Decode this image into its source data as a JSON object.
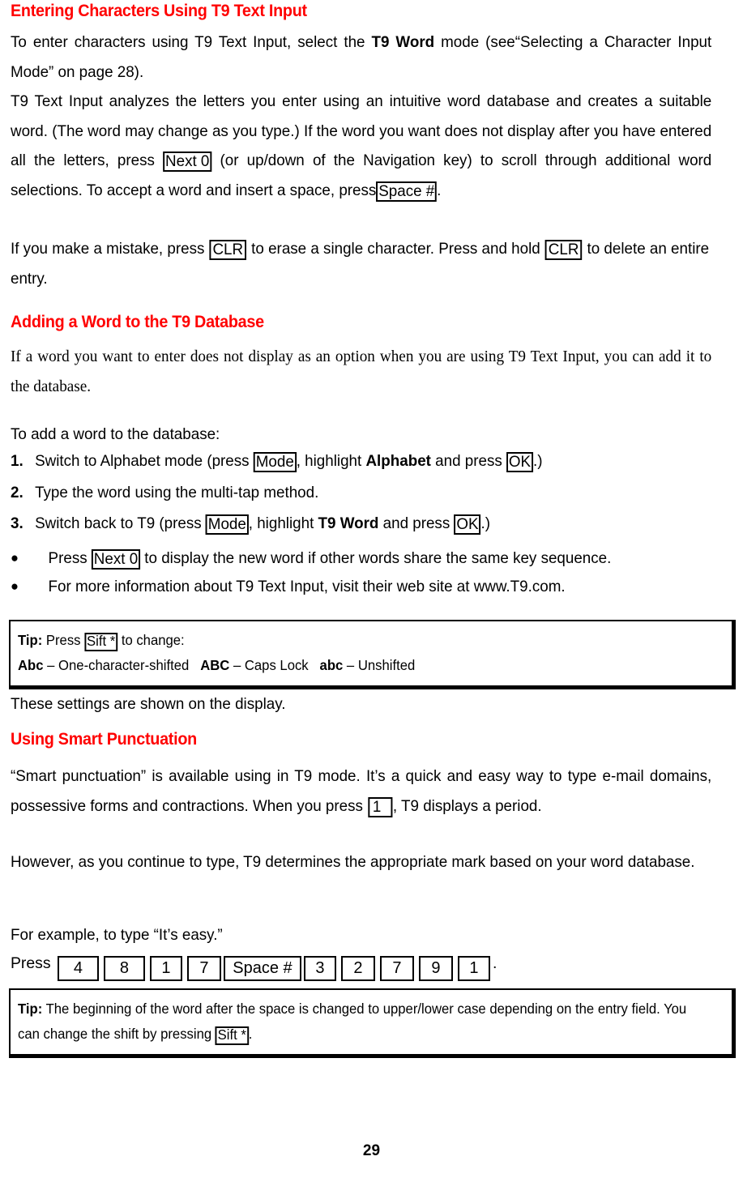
{
  "page": {
    "number": "29"
  },
  "sections": [
    {
      "heading": "Entering Characters Using T9 Text Input",
      "paragraphs": [
        "To enter characters using T9 Text Input, select the  T9 Word  mode (see“Selecting a Character Input Mode” on page 28).",
        "T9 Text Input analyzes the letters you enter using an intuitive word database and creates a suitable word. (The word may change as you type.) If the word you want does not display after you have entered all the letters, press  Next 0 (or up/down of the Navigation key) to scroll through additional word selections. To accept a word and insert a space, press Space #.",
        "If you make a mistake, press  CLR  to erase a single character. Press and hold CLR  to delete an entire entry."
      ]
    },
    {
      "heading": "Adding a Word to the T9 Database",
      "paragraphs": [
        "If a word you want to enter does not display as an option when you are using T9 Text Input, you can add it to the database."
      ]
    },
    {
      "heading": "Using Smart Punctuation",
      "paragraphs": [
        "“Smart punctuation” is available using in T9 mode. It’s a quick and easy way to type e-mail domains, possessive forms and contractions. When you press  1 , T9 displays a period.",
        "However, as you continue to type, T9 determines the appropriate mark based on your word database.",
        "For example, to type “It’s easy.”"
      ]
    }
  ],
  "body": {
    "p1_a": "To enter characters using T9 Text Input, select the",
    "p1_bold": "T9 Word",
    "p1_b": "mode (see“Selecting a Character Input Mode” on page 28).",
    "p2_a": "T9 Text Input analyzes the letters you enter using an intuitive word database and creates a suitable word. (The word may change as you type.) If the word you want does not display after you have entered all the letters, press",
    "p2_key1": "Next 0",
    "p2_b": "(or up/down of the Navigation key) to scroll through additional word selections. To accept a word and insert a space, press",
    "p2_key2": "Space #",
    "p2_c": ".",
    "p3_a": "If you make a mistake, press",
    "p3_key1": "CLR",
    "p3_b": "to erase a single character. Press and hold",
    "p3_key2": "CLR",
    "p3_c": "to delete an entire entry.",
    "p4_serif": "If a word you want to enter does not display as an option when you are using T9 Text Input, you can add it to the database.",
    "intro_steps": "To add a word to the database:",
    "after_tip1": "These settings are shown on the display.",
    "p5_a": "“Smart punctuation” is available using in T9 mode. It’s a quick and easy way to type e-mail domains, possessive forms and contractions. When you press",
    "p5_key1": "1",
    "p5_b": ", T9 displays a period.",
    "p6": "However, as you continue to type, T9 determines the appropriate mark based on your word database.",
    "p7": "For example, to type “It’s easy.”",
    "press_label": "Press"
  },
  "steps": [
    {
      "num": "1.",
      "pre": "Switch to Alphabet mode (press",
      "key1": "Mode",
      "mid": ", highlight",
      "bold": "Alphabet",
      "mid2": "and press",
      "key2": "OK",
      "post": ".)"
    },
    {
      "num": "2.",
      "pre": "Type the word using the multi-tap method.",
      "key1": "",
      "mid": "",
      "bold": "",
      "mid2": "",
      "key2": "",
      "post": ""
    },
    {
      "num": "3.",
      "pre": "Switch back to T9 (press",
      "key1": "Mode",
      "mid": ", highlight",
      "bold": "T9 Word",
      "mid2": "and press",
      "key2": "OK",
      "post": ".)"
    }
  ],
  "bullets": [
    {
      "marker": "●",
      "pre": "Press",
      "key": "Next 0",
      "post": "to display the new word if other words share the same key sequence."
    },
    {
      "marker": "●",
      "pre": "For more information about T9 Text Input, visit their web site at www.T9.com.",
      "key": "",
      "post": ""
    }
  ],
  "tips": [
    {
      "label": "Tip:",
      "line1_pre": "Press",
      "line1_key": "Sift *",
      "line1_post": "to change:",
      "line2": [
        {
          "bold": "Abc",
          "text": "– One-character-shifted"
        },
        {
          "bold": "ABC",
          "text": "– Caps Lock"
        },
        {
          "bold": "abc",
          "text": "– Unshifted"
        }
      ]
    },
    {
      "label": "Tip:",
      "text_a": "The beginning of the word after the space is changed to upper/lower case depending on the entry field. You can change the shift by pressing",
      "key": "Sift *",
      "text_b": "."
    }
  ],
  "key_sequence": {
    "label": "Press",
    "keys": [
      "4",
      "8",
      "1",
      "7",
      "Space #",
      "3",
      "2",
      "7",
      "9",
      "1"
    ],
    "trailing": "."
  },
  "colors": {
    "heading": "#ff0000",
    "text": "#000000",
    "background": "#ffffff"
  }
}
